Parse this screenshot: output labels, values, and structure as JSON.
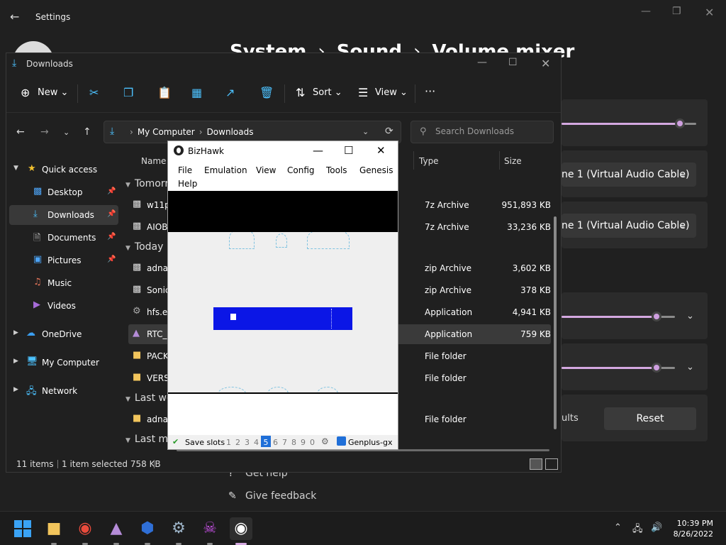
{
  "settings": {
    "title": "Settings",
    "breadcrumb": [
      "System",
      "Sound",
      "Volume mixer"
    ],
    "output_device_1": "ne 1 (Virtual Audio Cable)",
    "output_device_2": "ne 1 (Virtual Audio Cable)",
    "defaults_tail": "ults",
    "reset_label": "Reset",
    "get_help": "Get help",
    "give_feedback": "Give feedback",
    "volume_level": 0.88,
    "slider2_level": 0.84,
    "slider3_level": 0.84
  },
  "explorer": {
    "title": "Downloads",
    "toolbar": {
      "new_label": "New",
      "sort_label": "Sort",
      "view_label": "View",
      "more_label": "···"
    },
    "address": {
      "root": "My Computer",
      "current": "Downloads"
    },
    "search_placeholder": "Search Downloads",
    "sidebar": [
      {
        "label": "Quick access",
        "icon": "star-icon"
      },
      {
        "label": "Desktop",
        "icon": "desktop-icon"
      },
      {
        "label": "Downloads",
        "icon": "download-icon"
      },
      {
        "label": "Documents",
        "icon": "documents-icon"
      },
      {
        "label": "Pictures",
        "icon": "pictures-icon"
      },
      {
        "label": "Music",
        "icon": "music-icon"
      },
      {
        "label": "Videos",
        "icon": "videos-icon"
      },
      {
        "label": "OneDrive",
        "icon": "cloud-icon"
      },
      {
        "label": "My Computer",
        "icon": "computer-icon"
      },
      {
        "label": "Network",
        "icon": "network-icon"
      }
    ],
    "columns": {
      "name": "Name",
      "type": "Type",
      "size": "Size"
    },
    "groups": [
      "Tomorr",
      "Today (",
      "Last we",
      "Last mo"
    ],
    "rows": [
      {
        "name": "w11p",
        "type": "7z Archive",
        "size": "951,893 KB"
      },
      {
        "name": "AIOB",
        "type": "7z Archive",
        "size": "33,236 KB"
      },
      {
        "name": "adnau",
        "type": "zip Archive",
        "size": "3,602 KB"
      },
      {
        "name": "Sonic",
        "type": "zip Archive",
        "size": "378 KB"
      },
      {
        "name": "hfs.ex",
        "type": "Application",
        "size": "4,941 KB"
      },
      {
        "name": "RTC_L",
        "type": "Application",
        "size": "759 KB"
      },
      {
        "name": "PACK",
        "type": "File folder",
        "size": ""
      },
      {
        "name": "VERSI",
        "type": "File folder",
        "size": ""
      },
      {
        "name": "adnau",
        "type": "File folder",
        "size": ""
      }
    ],
    "status": {
      "count": "11 items",
      "selected": "1 item selected  758 KB"
    }
  },
  "bizhawk": {
    "title": "BizHawk",
    "menu": [
      "File",
      "Emulation",
      "View",
      "Config",
      "Tools",
      "Genesis",
      "Help"
    ],
    "status": {
      "save_slots_label": "Save slots",
      "slots": [
        "1",
        "2",
        "3",
        "4",
        "5",
        "6",
        "7",
        "8",
        "9",
        "0"
      ],
      "active_slot": "5",
      "core": "Genplus-gx"
    }
  },
  "taskbar": {
    "time": "10:39 PM",
    "date": "8/26/2022"
  },
  "colors": {
    "accent_blue": "#4cc2ff",
    "slider_accent": "#d4a8e0",
    "emu_blue": "#0b16e6"
  }
}
